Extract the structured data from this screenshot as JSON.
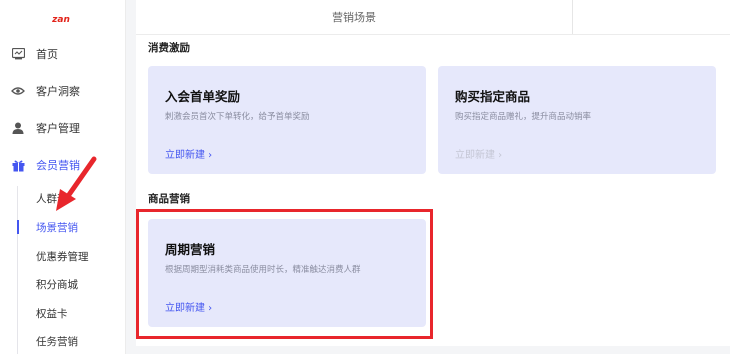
{
  "logo_text": "zan",
  "sidebar": {
    "items": [
      {
        "label": "首页",
        "icon": "dashboard-icon"
      },
      {
        "label": "客户洞察",
        "icon": "eye-icon"
      },
      {
        "label": "客户管理",
        "icon": "user-icon"
      },
      {
        "label": "会员营销",
        "icon": "gift-icon"
      }
    ],
    "sub_items": [
      {
        "label": "人群运"
      },
      {
        "label": "场景营销"
      },
      {
        "label": "优惠券管理"
      },
      {
        "label": "积分商城"
      },
      {
        "label": "权益卡"
      },
      {
        "label": "任务营销"
      }
    ]
  },
  "main": {
    "tab_label": "营销场景",
    "sections": [
      {
        "title": "消费激励",
        "cards": [
          {
            "title": "入会首单奖励",
            "desc": "刺激会员首次下单转化，给予首单奖励",
            "link": "立即新建 ›",
            "link_enabled": true
          },
          {
            "title": "购买指定商品",
            "desc": "购买指定商品赠礼，提升商品动销率",
            "link": "立即新建 ›",
            "link_enabled": false
          }
        ]
      },
      {
        "title": "商品营销",
        "cards": [
          {
            "title": "周期营销",
            "desc": "根据周期型消耗类商品使用时长，精准触达消费人群",
            "link": "立即新建 ›",
            "link_enabled": true
          }
        ]
      }
    ]
  },
  "colors": {
    "accent": "#4456f0",
    "highlight": "#e8262c",
    "card_bg": "#e6e8fb"
  }
}
